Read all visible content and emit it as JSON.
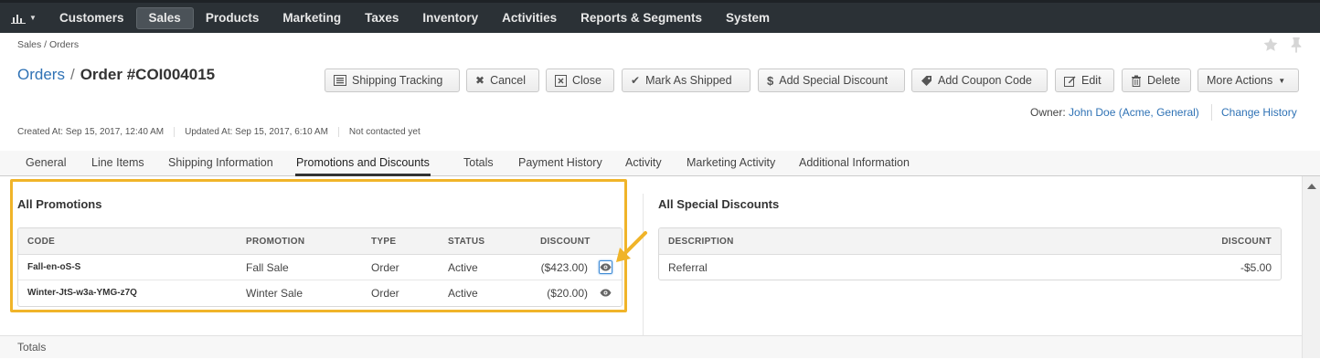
{
  "nav": {
    "items": [
      "Customers",
      "Sales",
      "Products",
      "Marketing",
      "Taxes",
      "Inventory",
      "Activities",
      "Reports & Segments",
      "System"
    ],
    "active": "Sales"
  },
  "breadcrumb": "Sales / Orders",
  "title": {
    "parent": "Orders",
    "separator": "/",
    "current": "Order #COI004015"
  },
  "actions": {
    "shipping_tracking": "Shipping Tracking",
    "cancel": "Cancel",
    "close": "Close",
    "mark_as_shipped": "Mark As Shipped",
    "add_special_discount": "Add Special Discount",
    "add_coupon_code": "Add Coupon Code",
    "edit": "Edit",
    "delete": "Delete",
    "more_actions": "More Actions"
  },
  "owner": {
    "label": "Owner:",
    "name": "John Doe",
    "org": "(Acme, General)",
    "change_history": "Change History"
  },
  "meta": {
    "created": "Created At: Sep 15, 2017, 12:40 AM",
    "updated": "Updated At: Sep 15, 2017, 6:10 AM",
    "contacted": "Not contacted yet"
  },
  "tabs": [
    "General",
    "Line Items",
    "Shipping Information",
    "Promotions and Discounts",
    "Totals",
    "Payment History",
    "Activity",
    "Marketing Activity",
    "Additional Information"
  ],
  "active_tab": "Promotions and Discounts",
  "promotions": {
    "title": "All Promotions",
    "columns": {
      "code": "CODE",
      "promotion": "PROMOTION",
      "type": "TYPE",
      "status": "STATUS",
      "discount": "DISCOUNT"
    },
    "rows": [
      {
        "code": "Fall-en-oS-S",
        "promotion": "Fall Sale",
        "type": "Order",
        "status": "Active",
        "discount": "($423.00)"
      },
      {
        "code": "Winter-JtS-w3a-YMG-z7Q",
        "promotion": "Winter Sale",
        "type": "Order",
        "status": "Active",
        "discount": "($20.00)"
      }
    ]
  },
  "special_discounts": {
    "title": "All Special Discounts",
    "columns": {
      "description": "DESCRIPTION",
      "discount": "DISCOUNT"
    },
    "rows": [
      {
        "description": "Referral",
        "discount": "-$5.00"
      }
    ]
  },
  "totals_section": "Totals",
  "colors": {
    "nav_bg": "#2b3136",
    "link": "#2f72b5",
    "highlight": "#f0b429"
  }
}
